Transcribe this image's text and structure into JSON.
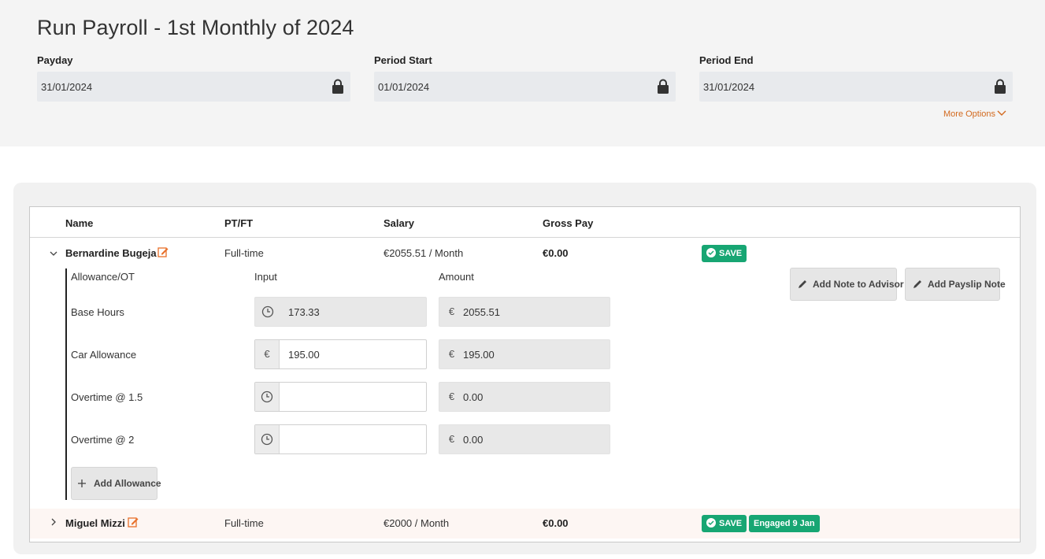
{
  "header": {
    "title": "Run Payroll - 1st Monthly of 2024",
    "payday": {
      "label": "Payday",
      "value": "31/01/2024"
    },
    "period_start": {
      "label": "Period Start",
      "value": "01/01/2024"
    },
    "period_end": {
      "label": "Period End",
      "value": "31/01/2024"
    },
    "more_options": "More Options"
  },
  "table": {
    "columns": [
      "Name",
      "PT/FT",
      "Salary",
      "Gross Pay"
    ],
    "employees": [
      {
        "name": "Bernardine Bugeja",
        "type": "Full-time",
        "salary": "€2055.51 / Month",
        "gross": "€0.00",
        "save": "SAVE",
        "expanded": true
      },
      {
        "name": "Miguel Mizzi",
        "type": "Full-time",
        "salary": "€2000 / Month",
        "gross": "€0.00",
        "save": "SAVE",
        "badge": "Engaged 9 Jan",
        "expanded": false
      }
    ]
  },
  "allowances": {
    "headers": [
      "Allowance/OT",
      "Input",
      "Amount"
    ],
    "currency": "€",
    "rows": [
      {
        "label": "Base Hours",
        "input": "173.33",
        "amount": "2055.51"
      },
      {
        "label": "Car Allowance",
        "input": "195.00",
        "amount": "195.00"
      },
      {
        "label": "Overtime @ 1.5",
        "input": "",
        "amount": "0.00"
      },
      {
        "label": "Overtime @ 2",
        "input": "",
        "amount": "0.00"
      }
    ],
    "add_button": "Add Allowance",
    "note_advisor": "Add Note to Advisor",
    "payslip_note": "Add Payslip Note"
  },
  "colors": {
    "accent": "#d2691e",
    "success": "#17a673",
    "header_bg": "#f4f4f4",
    "field_bg": "#e8eaed"
  }
}
